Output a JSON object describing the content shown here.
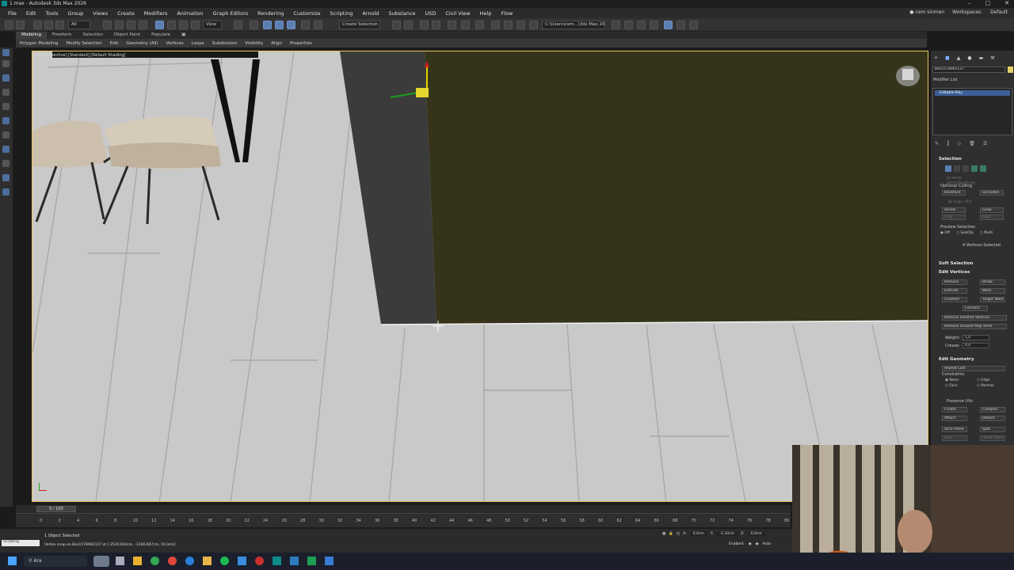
{
  "window": {
    "title": "1.max - Autodesk 3ds Max 2026"
  },
  "menubar": {
    "items": [
      "File",
      "Edit",
      "Tools",
      "Group",
      "Views",
      "Create",
      "Modifiers",
      "Animation",
      "Graph Editors",
      "Rendering",
      "Customize",
      "Scripting",
      "Arnold",
      "Substance",
      "USD",
      "Civil View",
      "Help",
      "Flow"
    ],
    "user": "cem sinmen",
    "workspaces_label": "Workspaces:",
    "workspace_value": "Default"
  },
  "toolbar": {
    "selection_set": "Create Selection Se",
    "path": "C:\\Users\\cem...\\3ds Max 2026"
  },
  "ribbon": {
    "tabs": [
      "Modeling",
      "Freeform",
      "Selection",
      "Object Paint",
      "Populate"
    ],
    "subitems": [
      "Polygon Modeling",
      "Modify Selection",
      "Edit",
      "Geometry (All)",
      "Vertices",
      "Loops",
      "Subdivision",
      "Visibility",
      "Align",
      "Properties"
    ]
  },
  "viewport": {
    "label": "[+] [Perspective] [Standard] [Default Shading]"
  },
  "command_panel": {
    "object_name": "Box1578962127",
    "modifier_list": "Modifier List",
    "stack_item": "Editable Poly",
    "selection": {
      "title": "Selection",
      "by_vertex": "By Vertex",
      "ignore_backfacing": "Ignore Backfacing",
      "by_angle": "By Angle:",
      "by_angle_value": "45,0",
      "optional_culling": "Optional Culling",
      "backface": "Backface",
      "occluded": "Occluded",
      "shrink": "Shrink",
      "grow": "Grow",
      "ring": "Ring",
      "loop": "Loop",
      "preview_selection": "Preview Selection",
      "preview_options": [
        "Off",
        "SubObj",
        "Multi"
      ],
      "status": "4 Vertices Selected"
    },
    "soft_selection": "Soft Selection",
    "edit_vertices": {
      "title": "Edit Vertices",
      "buttons": [
        "Remove",
        "Break",
        "Extrude",
        "Weld",
        "Chamfer",
        "Target Weld",
        "Connect",
        "Remove Isolated Vertices",
        "Remove Unused Map Verts"
      ],
      "weight_label": "Weight:",
      "weight_value": "1,0",
      "crease_label": "Crease:",
      "crease_value": "0,0"
    },
    "edit_geometry": {
      "title": "Edit Geometry",
      "repeat_last": "Repeat Last",
      "constraints": "Constraints",
      "constraint_options": [
        "None",
        "Edge",
        "Face",
        "Normal"
      ],
      "preserve_uvs": "Preserve UVs",
      "buttons": [
        "Create",
        "Collapse",
        "Attach",
        "Detach",
        "Slice Plane",
        "Split",
        "Slice",
        "Reset Plane"
      ]
    }
  },
  "timeline": {
    "frame_display": "0 / 100",
    "ticks": [
      "0",
      "2",
      "4",
      "6",
      "8",
      "10",
      "12",
      "14",
      "16",
      "18",
      "20",
      "22",
      "24",
      "26",
      "28",
      "30",
      "32",
      "34",
      "36",
      "38",
      "40",
      "42",
      "44",
      "46",
      "48",
      "50",
      "52",
      "54",
      "56",
      "58",
      "60",
      "62",
      "64",
      "66",
      "68",
      "70",
      "72",
      "74",
      "76",
      "78",
      "80"
    ]
  },
  "statusbar": {
    "maxscript": "Scripting",
    "selected": "1 Object Selected",
    "prompt": "Vertex snap on Box1578962127 at [-3520,034cm, -1240,697cm, 10,0cm]",
    "x_label": "X:",
    "x_value": "0,0cm",
    "y_label": "Y:",
    "y_value": "-2,34cm",
    "z_label": "Z:",
    "z_value": "0,0cm",
    "enabled": "Enabled:",
    "auto": "Auto"
  },
  "taskbar": {
    "search": "Ara"
  },
  "colors": {
    "wall": "#35341a",
    "wall_side": "#3a3a3a",
    "floor": "#c9c9c9",
    "selection_blue": "#3c5f96"
  }
}
